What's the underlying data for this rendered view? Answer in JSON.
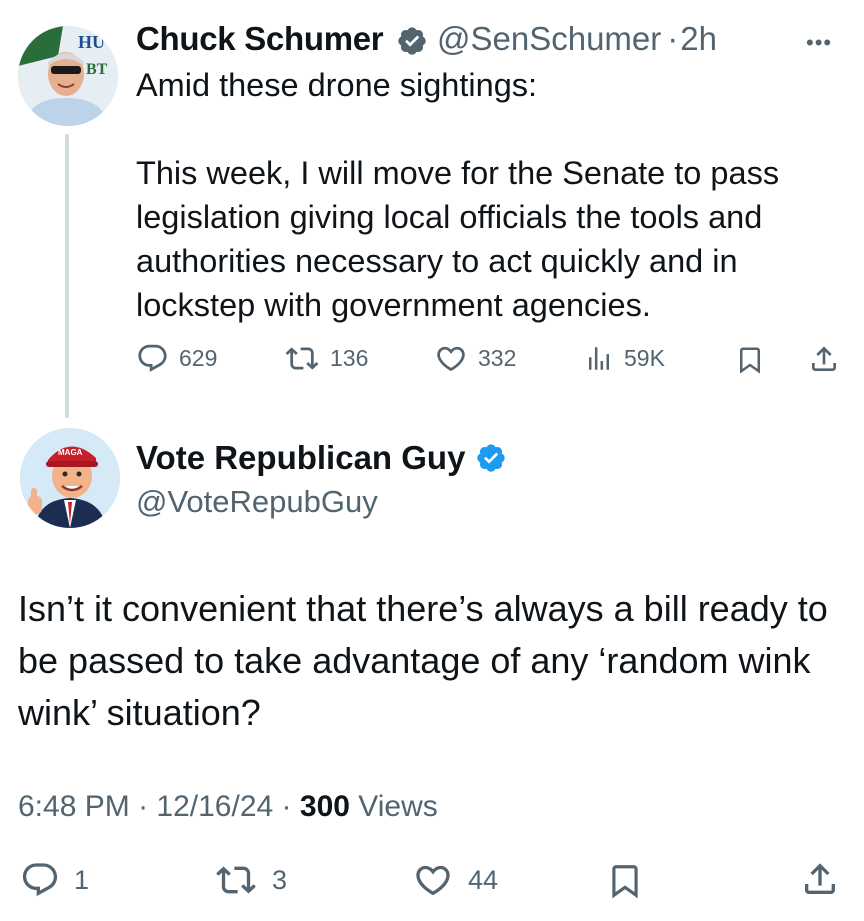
{
  "parent_tweet": {
    "author_name": "Chuck Schumer",
    "handle": "@SenSchumer",
    "separator": "·",
    "time": "2h",
    "more_label": "•••",
    "text": "Amid these drone sightings:\n\nThis week, I will move for the Senate to pass legislation giving local officials the tools and authorities necessary to act quickly and in lockstep with government agencies.",
    "actions": {
      "replies": "629",
      "reposts": "136",
      "likes": "332",
      "views": "59K"
    }
  },
  "reply_tweet": {
    "author_name": "Vote Republican Guy",
    "handle": "@VoteRepubGuy",
    "text": "Isn’t it convenient that there’s always a bill ready to be passed to take advantage of any ‘random wink wink’ situation?",
    "meta": {
      "time": "6:48 PM",
      "sep1": "·",
      "date": "12/16/24",
      "sep2": "·",
      "views_count": "300",
      "views_label": "Views"
    },
    "actions": {
      "replies": "1",
      "reposts": "3",
      "likes": "44"
    }
  },
  "colors": {
    "text": "#0f1419",
    "secondary": "#536471",
    "verified": "#1d9bf0",
    "thread_line": "#cfd9de"
  }
}
